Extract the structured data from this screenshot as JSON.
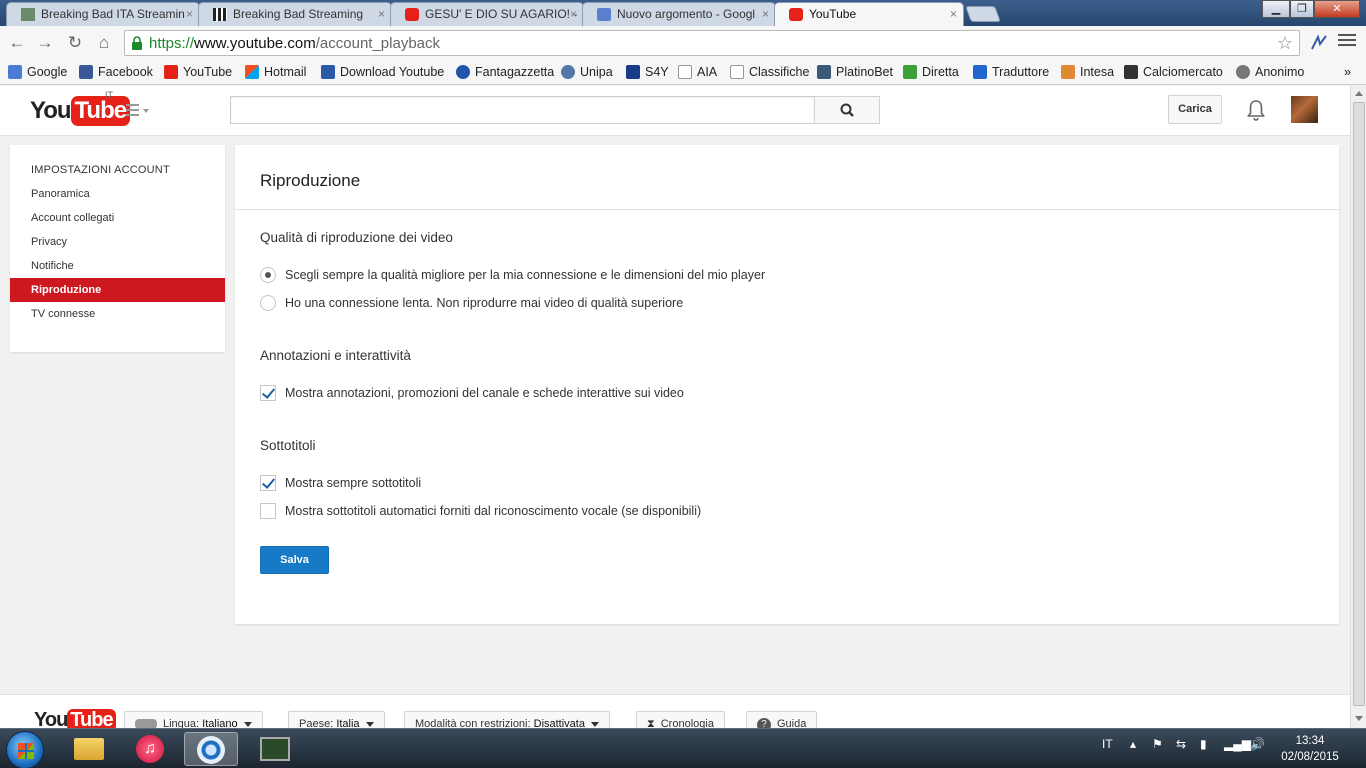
{
  "browser": {
    "tabs": [
      {
        "title": "Breaking Bad ITA Streamin",
        "icon": "site-icon"
      },
      {
        "title": "Breaking Bad Streaming",
        "icon": "clapper-icon"
      },
      {
        "title": "GESU' E DIO SU AGARIO! -",
        "icon": "youtube-icon"
      },
      {
        "title": "Nuovo argomento - Googl",
        "icon": "google-groups-icon"
      },
      {
        "title": "YouTube",
        "icon": "youtube-icon"
      }
    ],
    "tab_close": "×",
    "url": {
      "protocol": "https://",
      "host": "www.youtube.com",
      "path": "/account_playback"
    },
    "bookmarks": [
      {
        "label": "Google",
        "color": "#4a7bd6"
      },
      {
        "label": "Facebook",
        "color": "#3b5998"
      },
      {
        "label": "YouTube",
        "color": "#e62117"
      },
      {
        "label": "Hotmail",
        "color": "#f0a020"
      },
      {
        "label": "Download Youtube",
        "color": "#2a5aa8"
      },
      {
        "label": "Fantagazzetta",
        "color": "#2255aa"
      },
      {
        "label": "Unipa",
        "color": "#5577aa"
      },
      {
        "label": "S4Y",
        "color": "#1a3a8a"
      },
      {
        "label": "AIA",
        "color": "#cccccc"
      },
      {
        "label": "Classifiche",
        "color": "#cccccc"
      },
      {
        "label": "PlatinoBet",
        "color": "#3a5a7a"
      },
      {
        "label": "Diretta",
        "color": "#3aa03a"
      },
      {
        "label": "Traduttore",
        "color": "#2266cc"
      },
      {
        "label": "Intesa",
        "color": "#dd8833"
      },
      {
        "label": "Calciomercato",
        "color": "#333333"
      },
      {
        "label": "Anonimo",
        "color": "#777777"
      }
    ]
  },
  "masthead": {
    "logo_you": "You",
    "logo_tube": "Tube",
    "country": "IT",
    "search_placeholder": "",
    "upload_label": "Carica"
  },
  "sidenav": {
    "header": "IMPOSTAZIONI ACCOUNT",
    "items": [
      {
        "label": "Panoramica",
        "active": false
      },
      {
        "label": "Account collegati",
        "active": false
      },
      {
        "label": "Privacy",
        "active": false
      },
      {
        "label": "Notifiche",
        "active": false
      },
      {
        "label": "Riproduzione",
        "active": true
      },
      {
        "label": "TV connesse",
        "active": false
      }
    ]
  },
  "main": {
    "title": "Riproduzione",
    "quality": {
      "heading": "Qualità di riproduzione dei video",
      "options": [
        {
          "label": "Scegli sempre la qualità migliore per la mia connessione e le dimensioni del mio player",
          "selected": true
        },
        {
          "label": "Ho una connessione lenta. Non riprodurre mai video di qualità superiore",
          "selected": false
        }
      ]
    },
    "annotations": {
      "heading": "Annotazioni e interattività",
      "options": [
        {
          "label": "Mostra annotazioni, promozioni del canale e schede interattive sui video",
          "checked": true
        }
      ]
    },
    "subtitles": {
      "heading": "Sottotitoli",
      "options": [
        {
          "label": "Mostra sempre sottotitoli",
          "checked": true
        },
        {
          "label": "Mostra sottotitoli automatici forniti dal riconoscimento vocale (se disponibili)",
          "checked": false
        }
      ]
    },
    "save_label": "Salva"
  },
  "footer": {
    "language_label": "Lingua:",
    "language_value": "Italiano",
    "country_label": "Paese:",
    "country_value": "Italia",
    "restricted_label": "Modalità con restrizioni:",
    "restricted_value": "Disattivata",
    "history_label": "Cronologia",
    "help_label": "Guida"
  },
  "taskbar": {
    "lang": "IT",
    "time": "13:34",
    "date": "02/08/2015"
  }
}
